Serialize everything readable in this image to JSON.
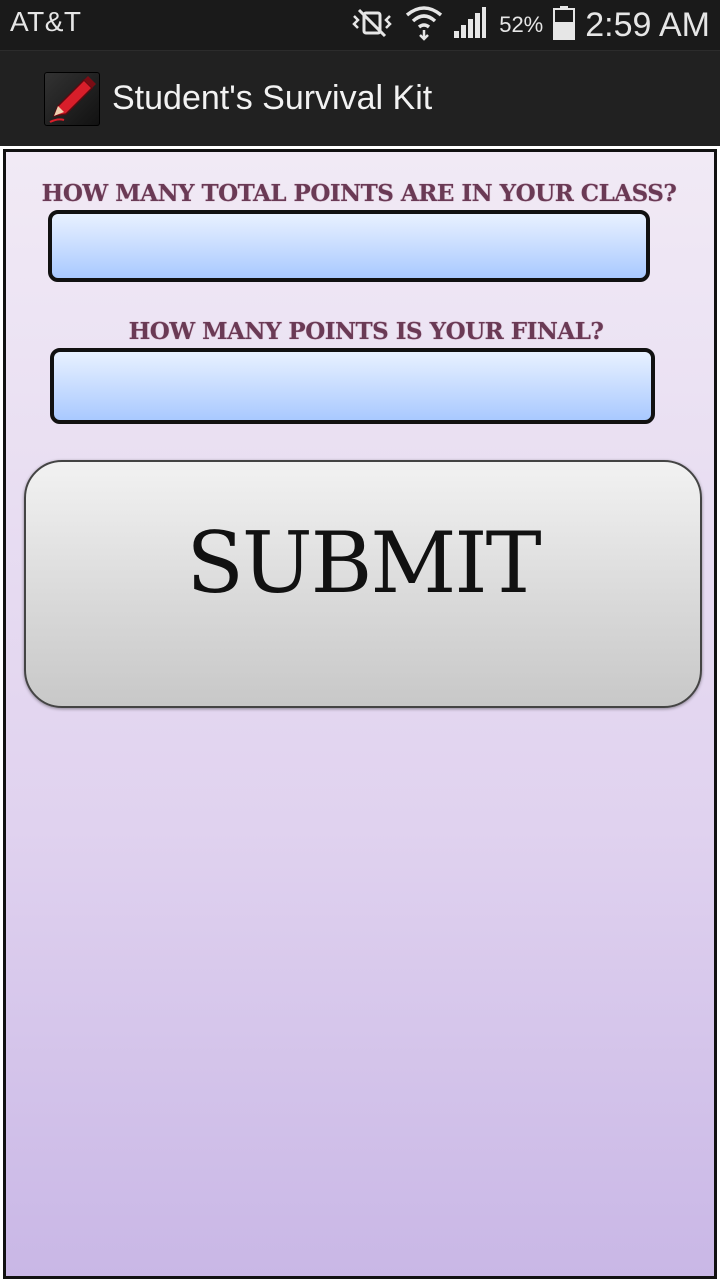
{
  "status_bar": {
    "carrier": "AT&T",
    "battery_percent": "52%",
    "time": "2:59 AM",
    "icons": [
      "vibrate-mute-icon",
      "wifi-icon",
      "signal-icon",
      "battery-icon"
    ]
  },
  "action_bar": {
    "app_icon": "pencil-icon",
    "title": "Student's Survival Kit"
  },
  "form": {
    "total_points_label": "HOW MANY TOTAL POINTS ARE IN YOUR CLASS?",
    "total_points_value": "",
    "final_points_label": "HOW MANY POINTS IS YOUR FINAL?",
    "final_points_value": "",
    "submit_label": "SUBMIT"
  },
  "colors": {
    "label": "#6a3a55",
    "input_fill_top": "#e8f1ff",
    "input_fill_bottom": "#a9c9ff",
    "background_top": "#f1eaf5",
    "background_bottom": "#c9b7e6"
  }
}
